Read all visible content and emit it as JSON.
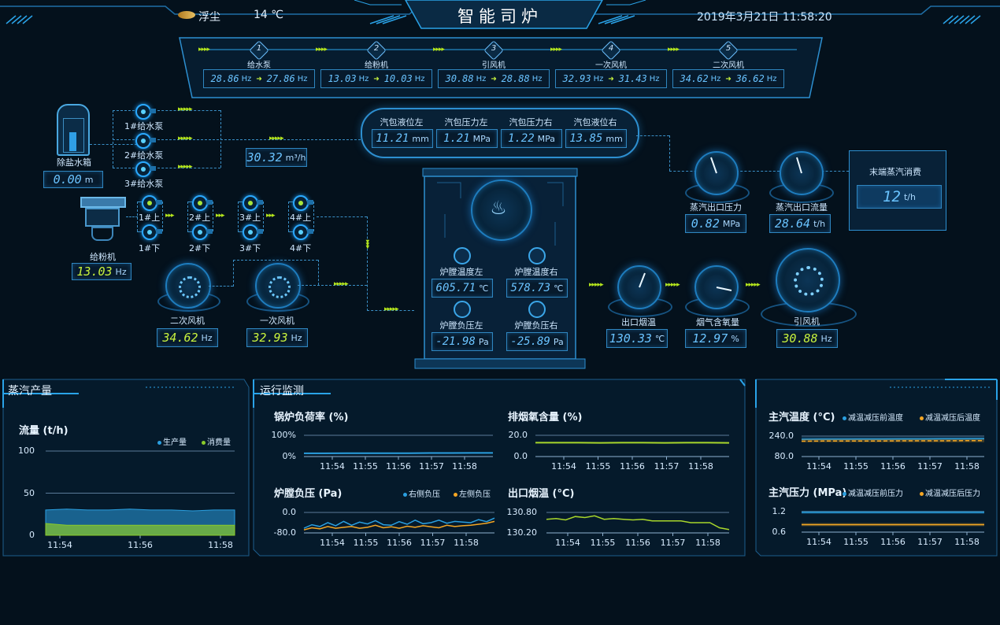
{
  "header": {
    "title": "智能司炉",
    "weather_label": "浮尘",
    "temperature": "14 ℃",
    "datetime": "2019年3月21日 11:58:20"
  },
  "steps": [
    {
      "num": "1",
      "label": "给水泵",
      "from": "28.86",
      "to": "27.86",
      "unit": "Hz"
    },
    {
      "num": "2",
      "label": "给粉机",
      "from": "13.03",
      "to": "10.03",
      "unit": "Hz"
    },
    {
      "num": "3",
      "label": "引风机",
      "from": "30.88",
      "to": "28.88",
      "unit": "Hz"
    },
    {
      "num": "4",
      "label": "一次风机",
      "from": "32.93",
      "to": "31.43",
      "unit": "Hz"
    },
    {
      "num": "5",
      "label": "二次风机",
      "from": "34.62",
      "to": "36.62",
      "unit": "Hz"
    }
  ],
  "water_tank": {
    "label": "除盐水箱",
    "value": "0.00",
    "unit": "m"
  },
  "pumps": [
    "1#给水泵",
    "2#给水泵",
    "3#给水泵"
  ],
  "flow": {
    "value": "30.32",
    "unit": "m³/h"
  },
  "feeders_top": [
    "1#上",
    "2#上",
    "3#上",
    "4#上"
  ],
  "feeders_bottom": [
    "1#下",
    "2#下",
    "3#下",
    "4#下"
  ],
  "powder_feeder": {
    "label": "给粉机",
    "value": "13.03",
    "unit": "Hz"
  },
  "secondary_fan": {
    "label": "二次风机",
    "value": "34.62",
    "unit": "Hz"
  },
  "primary_fan": {
    "label": "一次风机",
    "value": "32.93",
    "unit": "Hz"
  },
  "drum": {
    "items": [
      {
        "label": "汽包液位左",
        "value": "11.21",
        "unit": "mm"
      },
      {
        "label": "汽包压力左",
        "value": "1.21",
        "unit": "MPa"
      },
      {
        "label": "汽包压力右",
        "value": "1.22",
        "unit": "MPa"
      },
      {
        "label": "汽包液位右",
        "value": "13.85",
        "unit": "mm"
      }
    ]
  },
  "furnace": {
    "temp_left": {
      "label": "炉膛温度左",
      "value": "605.71",
      "unit": "℃"
    },
    "temp_right": {
      "label": "炉膛温度右",
      "value": "578.73",
      "unit": "℃"
    },
    "press_left": {
      "label": "炉膛负压左",
      "value": "-21.98",
      "unit": "Pa"
    },
    "press_right": {
      "label": "炉膛负压右",
      "value": "-25.89",
      "unit": "Pa"
    }
  },
  "steam_out_pressure": {
    "label": "蒸汽出口压力",
    "value": "0.82",
    "unit": "MPa"
  },
  "steam_out_flow": {
    "label": "蒸汽出口流量",
    "value": "28.64",
    "unit": "t/h"
  },
  "end_steam": {
    "label": "末端蒸汽消费",
    "value": "12",
    "unit": "t/h"
  },
  "exhaust_temp": {
    "label": "出口烟温",
    "value": "130.33",
    "unit": "℃"
  },
  "flue_oxygen": {
    "label": "烟气含氧量",
    "value": "12.97",
    "unit": "%"
  },
  "induced_fan": {
    "label": "引风机",
    "value": "30.88",
    "unit": "Hz"
  },
  "panels": {
    "steam_output": "蒸汽产量",
    "monitoring": "运行监测"
  },
  "time_ticks": [
    "11:54",
    "11:55",
    "11:56",
    "11:57",
    "11:58"
  ],
  "colors": {
    "accent": "#29a9ff",
    "green": "#b5e61d",
    "orange": "#f5a623",
    "bg": "#04111c"
  },
  "chart_data": [
    {
      "type": "area",
      "title": "流量 (t/h)",
      "categories": [
        "11:54",
        "11:56",
        "11:58"
      ],
      "ylim": [
        0,
        100
      ],
      "yticks": [
        "0",
        "50",
        "100"
      ],
      "series": [
        {
          "name": "生产量",
          "color": "#2a9fe0",
          "values": [
            30,
            31,
            30,
            30,
            31,
            30,
            30,
            29,
            30,
            30
          ]
        },
        {
          "name": "消费量",
          "color": "#8acb2b",
          "values": [
            14,
            12,
            12,
            12,
            12,
            12,
            12,
            12,
            12,
            12
          ]
        }
      ]
    },
    {
      "type": "line",
      "title": "锅炉负荷率 (%)",
      "categories": [
        "11:54",
        "11:55",
        "11:56",
        "11:57",
        "11:58"
      ],
      "yticks": [
        "100%",
        "0%"
      ],
      "ylim": [
        0,
        100
      ],
      "series": [
        {
          "color": "#2a9fe0",
          "values": [
            15,
            15,
            15.5,
            15.5,
            16,
            16,
            16.5,
            16.5,
            17,
            17
          ]
        }
      ]
    },
    {
      "type": "line",
      "title": "排烟氧含量 (%)",
      "categories": [
        "11:54",
        "11:55",
        "11:56",
        "11:57",
        "11:58"
      ],
      "yticks": [
        "20.0",
        "0.0"
      ],
      "ylim": [
        0,
        20
      ],
      "series": [
        {
          "color": "#a8d62b",
          "values": [
            13,
            13,
            13,
            12.9,
            13,
            13,
            12.9,
            13,
            13,
            12.9
          ]
        }
      ]
    },
    {
      "type": "line",
      "title": "炉膛负压 (Pa)",
      "categories": [
        "11:54",
        "11:55",
        "11:56",
        "11:57",
        "11:58"
      ],
      "yticks": [
        "0.0",
        "-80.0"
      ],
      "ylim": [
        -80,
        0
      ],
      "series": [
        {
          "name": "右侧负压",
          "color": "#2a9fe0",
          "values": [
            -62,
            -48,
            -55,
            -40,
            -52,
            -35,
            -50,
            -38,
            -45,
            -32,
            -48,
            -50,
            -36,
            -46,
            -30,
            -44,
            -40,
            -30,
            -42,
            -35,
            -38,
            -40,
            -28,
            -36,
            -22
          ]
        },
        {
          "name": "左侧负压",
          "color": "#f5a623",
          "values": [
            -68,
            -60,
            -64,
            -55,
            -62,
            -58,
            -55,
            -62,
            -58,
            -50,
            -60,
            -56,
            -62,
            -54,
            -58,
            -52,
            -56,
            -60,
            -50,
            -55,
            -52,
            -50,
            -46,
            -42,
            -35
          ]
        }
      ]
    },
    {
      "type": "line",
      "title": "出口烟温 (°C)",
      "categories": [
        "11:54",
        "11:55",
        "11:56",
        "11:57",
        "11:58"
      ],
      "yticks": [
        "130.80",
        "130.20"
      ],
      "ylim": [
        130.2,
        130.8
      ],
      "series": [
        {
          "color": "#a8d62b",
          "values": [
            130.6,
            130.62,
            130.58,
            130.68,
            130.65,
            130.7,
            130.6,
            130.62,
            130.6,
            130.58,
            130.6,
            130.55,
            130.55,
            130.55,
            130.55,
            130.5,
            130.5,
            130.5,
            130.35,
            130.3
          ]
        }
      ]
    },
    {
      "type": "line",
      "title": "主汽温度 (°C)",
      "categories": [
        "11:54",
        "11:55",
        "11:56",
        "11:57",
        "11:58"
      ],
      "yticks": [
        "240.0",
        "80.0"
      ],
      "ylim": [
        80,
        240
      ],
      "series": [
        {
          "name": "减温减压前温度",
          "color": "#2a9fe0",
          "values": [
            215,
            216,
            216,
            217,
            217,
            218,
            218,
            219,
            219,
            220
          ]
        },
        {
          "name": "减温减压后温度",
          "color": "#f5a623",
          "values": [
            200,
            201,
            201,
            202,
            202,
            203,
            203,
            203,
            204,
            204
          ]
        }
      ]
    },
    {
      "type": "line",
      "title": "主汽压力 (MPa)",
      "categories": [
        "11:54",
        "11:55",
        "11:56",
        "11:57",
        "11:58"
      ],
      "yticks": [
        "1.2",
        "0.6"
      ],
      "ylim": [
        0.6,
        1.2
      ],
      "series": [
        {
          "name": "减温减压前压力",
          "color": "#2a9fe0",
          "values": [
            1.18,
            1.18,
            1.18,
            1.18,
            1.18,
            1.18,
            1.18,
            1.18,
            1.18,
            1.18
          ]
        },
        {
          "name": "减温减压后压力",
          "color": "#f5a623",
          "values": [
            0.82,
            0.82,
            0.82,
            0.82,
            0.82,
            0.82,
            0.82,
            0.82,
            0.82,
            0.82
          ]
        }
      ]
    }
  ]
}
